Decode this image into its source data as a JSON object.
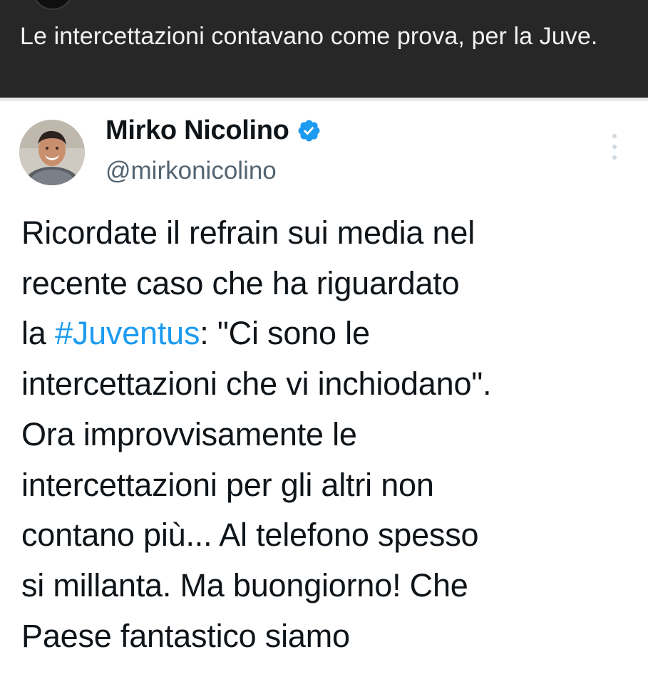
{
  "caption": {
    "text": "Le intercettazioni contavano come prova, per la Juve."
  },
  "tweet": {
    "author": {
      "display_name": "Mirko Nicolino",
      "handle": "@mirkonicolino",
      "verified_icon": "verified-badge-icon",
      "avatar_icon": "avatar-photo"
    },
    "more_icon": "more-options-icon",
    "text_lines": {
      "l1": "Ricordate il refrain sui media nel",
      "l2": "recente caso che ha riguardato",
      "l3_pre": "la ",
      "l3_hashtag": "#Juventus",
      "l3_post": ": \"Ci sono le",
      "l4": "intercettazioni che vi inchiodano\".",
      "l5": "Ora improvvisamente le",
      "l6": "intercettazioni per gli altri non",
      "l7": "contano più... Al telefono spesso",
      "l8": "si millanta. Ma buongiorno! Che",
      "l9": "Paese fantastico siamo"
    }
  },
  "colors": {
    "caption_bg": "#272727",
    "caption_text": "#f1f1f1",
    "name": "#0f1419",
    "handle": "#536471",
    "hashtag": "#1d9bf0",
    "verified": "#1d9bf0"
  }
}
